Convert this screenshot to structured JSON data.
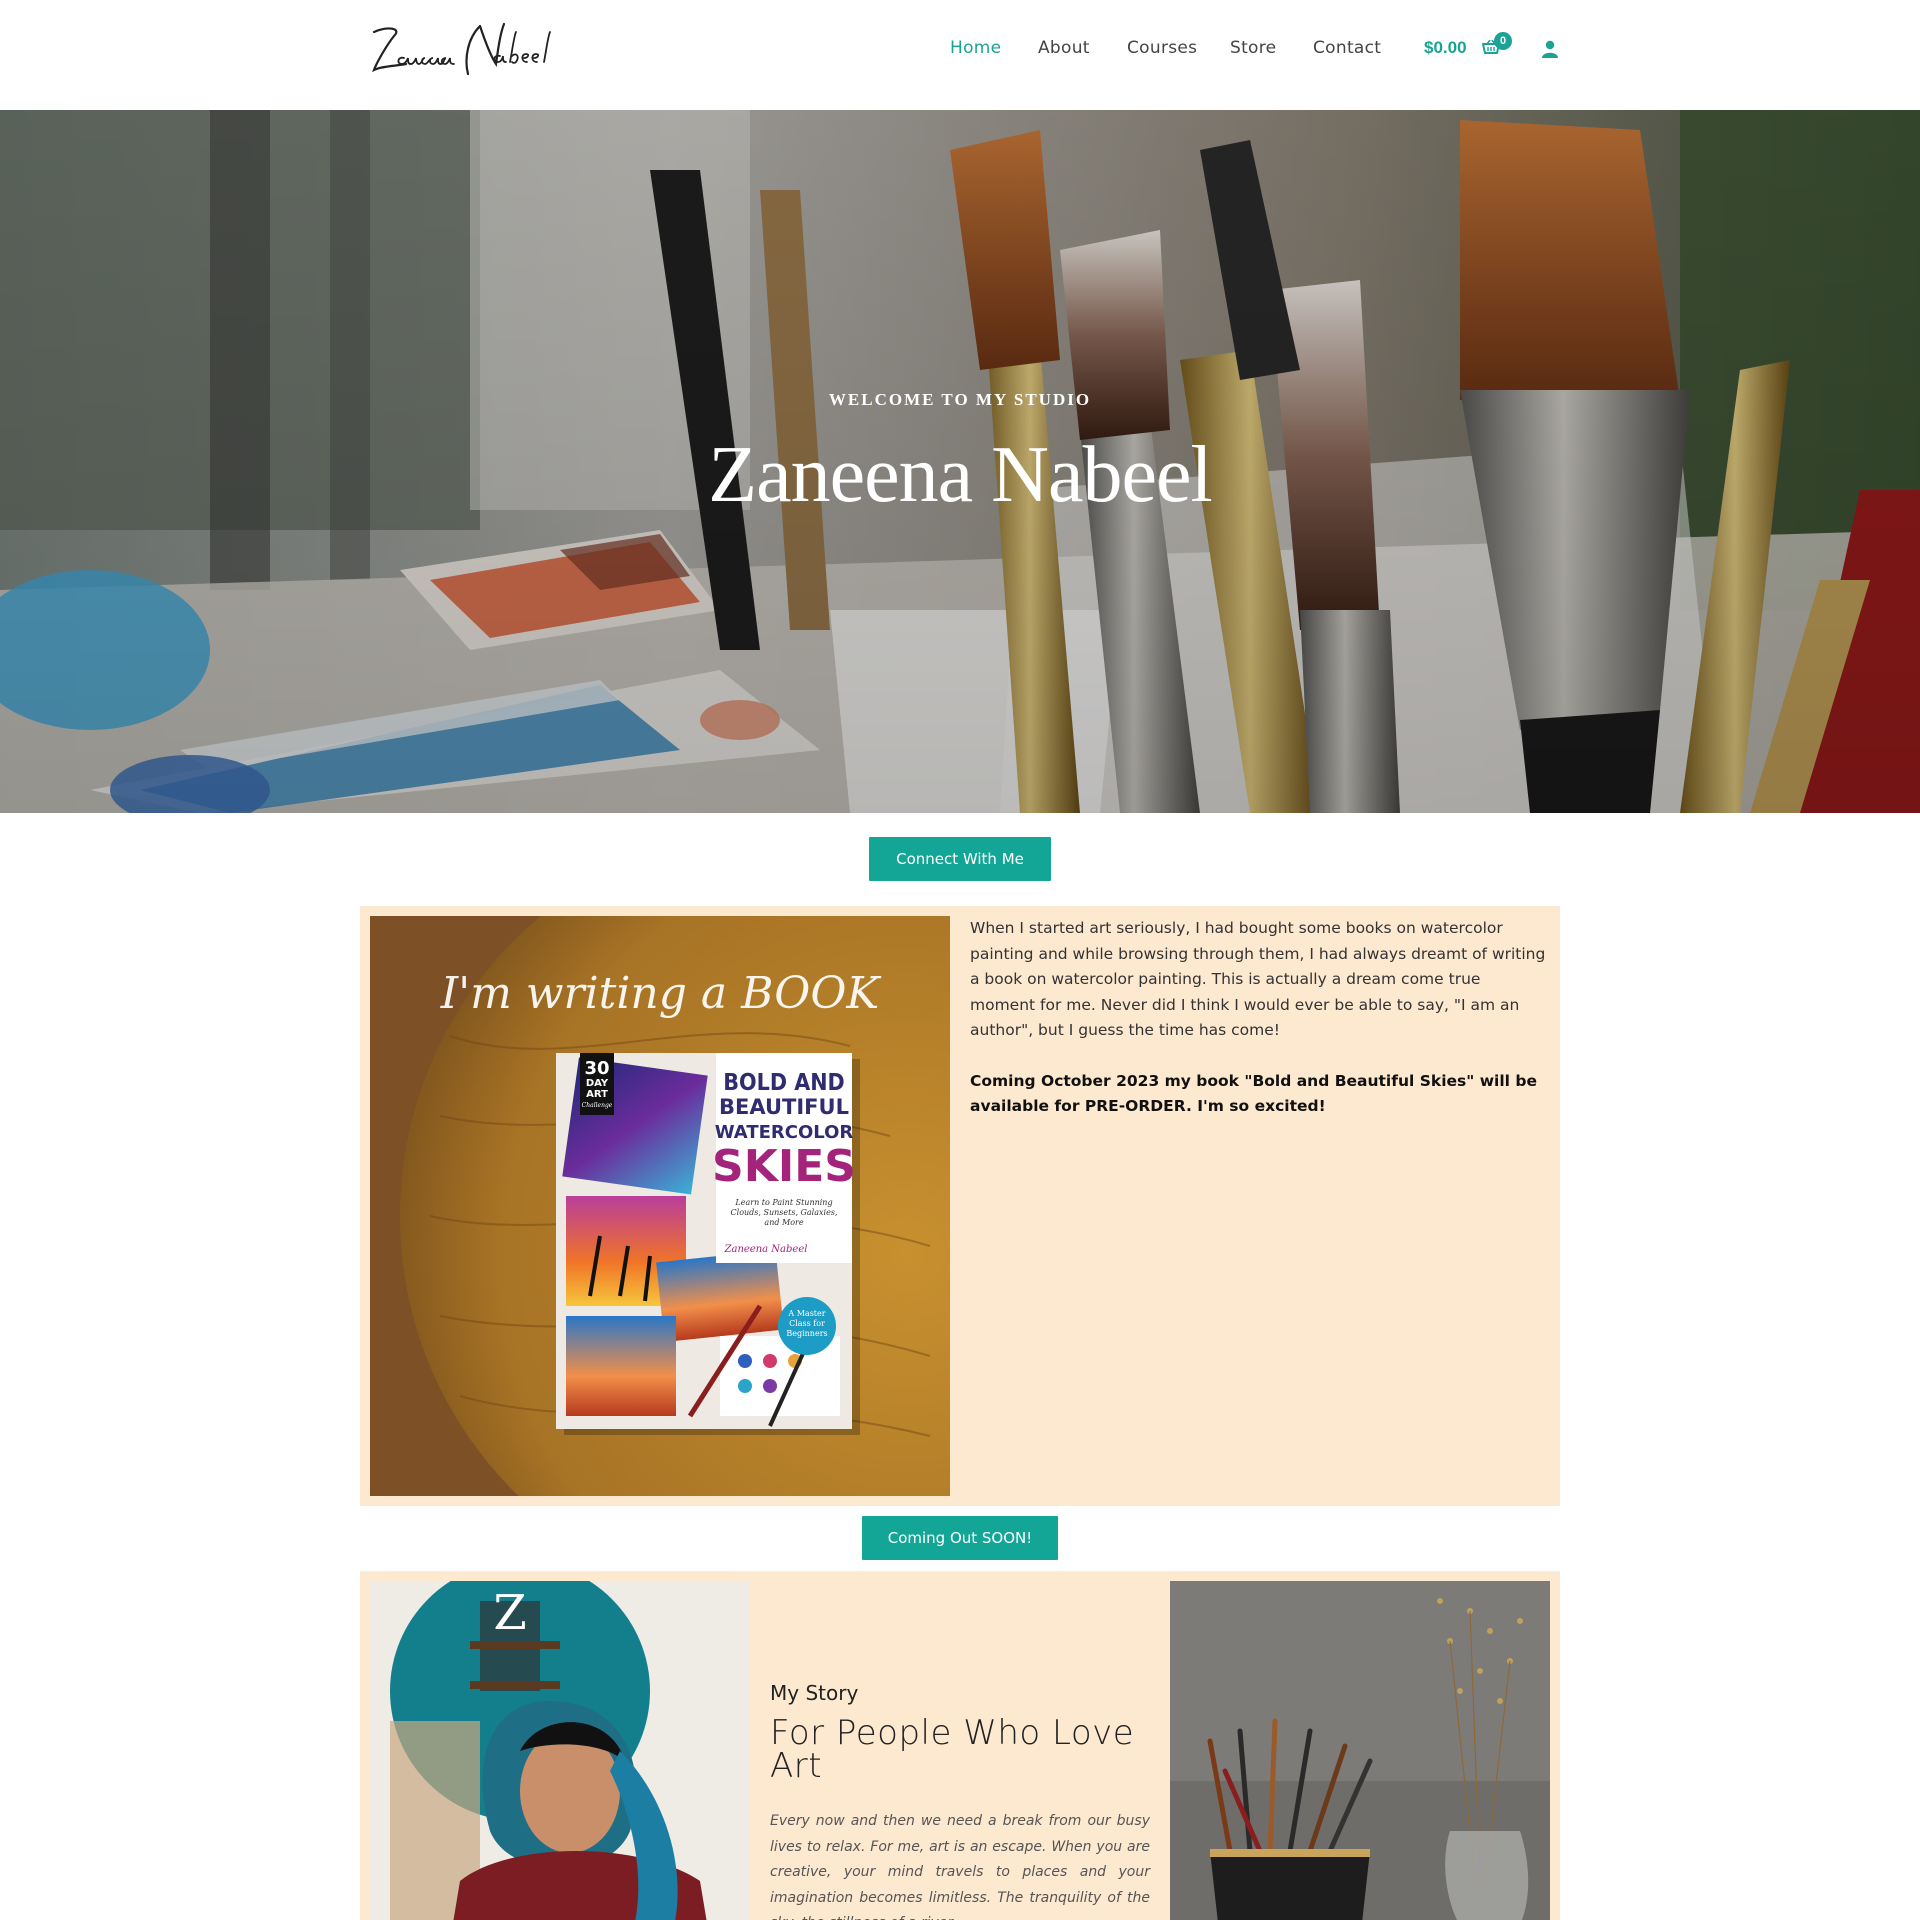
{
  "header": {
    "logo_text": "Zaneena Nabeel",
    "nav": [
      {
        "label": "Home",
        "active": true
      },
      {
        "label": "About",
        "active": false
      },
      {
        "label": "Courses",
        "active": false
      },
      {
        "label": "Store",
        "active": false
      },
      {
        "label": "Contact",
        "active": false
      }
    ],
    "cart_total": "$0.00",
    "cart_count": "0",
    "cart_icon": "cart-icon",
    "user_icon": "user-icon"
  },
  "hero": {
    "kicker": "WELCOME TO MY STUDIO",
    "title": "Zaneena Nabeel"
  },
  "connect_button": "Connect With Me",
  "book": {
    "image_script": "I'm writing a BOOK",
    "cover_badge": [
      "30",
      "DAY",
      "ART",
      "Challenge"
    ],
    "cover_title_lines": [
      "BOLD AND",
      "BEAUTIFUL",
      "WATERCOLOR",
      "SKIES"
    ],
    "cover_subtitle": "Learn to Paint Stunning Clouds, Sunsets, Galaxies, and More",
    "cover_author": "Zaneena Nabeel",
    "cover_seal": "A Master Class for Beginners",
    "paragraph": "When I started art seriously, I had bought some books on watercolor painting and while browsing through them, I had always dreamt of writing a book on watercolor painting. This is actually a dream come true moment for me. Never did I think I would ever be able to say, \"I am an author\", but I guess the time has come!",
    "announcement": "Coming October 2023 my book  \"Bold and Beautiful Skies\" will be available for PRE-ORDER. I'm so excited!"
  },
  "coming_button": "Coming Out SOON!",
  "story": {
    "kicker": "My Story",
    "heading": "For People Who Love Art",
    "body": "Every now and then we need a break from our busy lives to relax. For me, art is an escape. When you are creative, your mind travels to places and your imagination becomes limitless. The tranquility of the sky, the stillness of a river,"
  },
  "colors": {
    "accent": "#13a696",
    "panel_bg": "#fde8d0"
  }
}
